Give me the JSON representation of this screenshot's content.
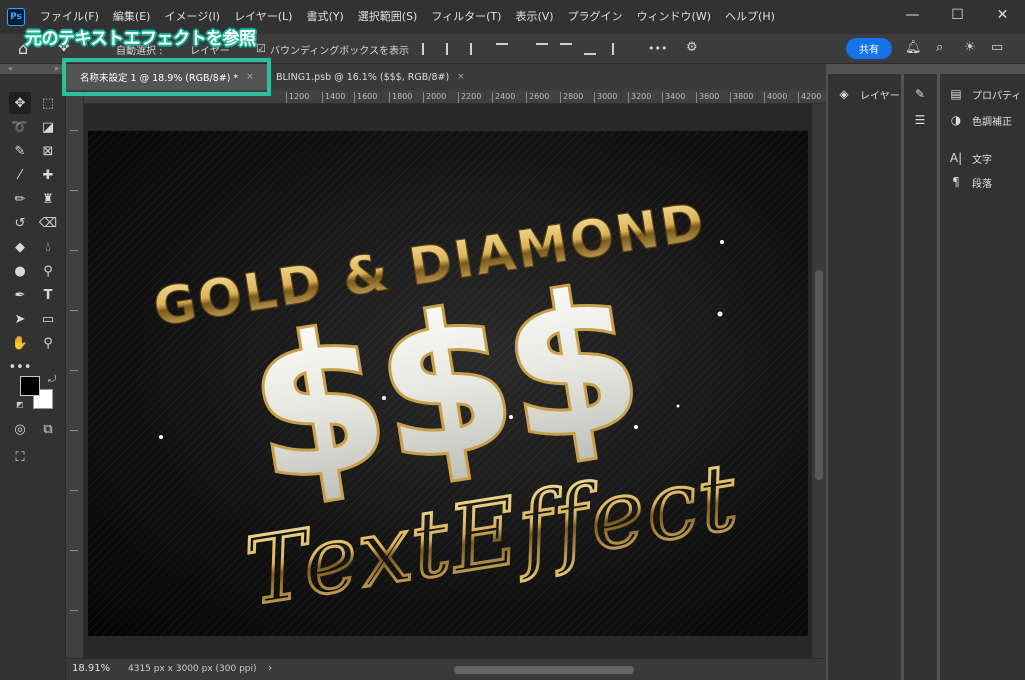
{
  "app": {
    "logo": "Ps"
  },
  "menu": [
    "ファイル(F)",
    "編集(E)",
    "イメージ(I)",
    "レイヤー(L)",
    "書式(Y)",
    "選択範囲(S)",
    "フィルター(T)",
    "表示(V)",
    "プラグイン",
    "ウィンドウ(W)",
    "ヘルプ(H)"
  ],
  "window": {
    "minimize": "—",
    "maximize": "☐",
    "close": "✕"
  },
  "options": {
    "auto_select": "自動選択 :",
    "layer_select": "レイヤー",
    "bounding_box": "バウンディングボックスを表示",
    "more": "•••",
    "share": "共有"
  },
  "annotation": {
    "title": "元のテキストエフェクトを参照"
  },
  "tabs": [
    {
      "label": "名称未設定 1 @ 18.9% (RGB/8#) *",
      "close": "×"
    },
    {
      "label": "BLING1.psb @ 16.1% ($$$, RGB/8#)",
      "close": "×"
    }
  ],
  "ruler": [
    "1200",
    "1400",
    "1600",
    "1800",
    "2000",
    "2200",
    "2400",
    "2600",
    "2800",
    "3000",
    "3200",
    "3400",
    "3600",
    "3800",
    "4000",
    "4200"
  ],
  "artwork": {
    "line1": "GOLD & DIAMOND",
    "line2": "$$$",
    "line3": "TextEffect",
    "colors": {
      "gold": "#d9b25a",
      "gold_dark": "#7a5a1e",
      "diamond": "#e8e8e2",
      "background": "#0c0c0c"
    }
  },
  "status": {
    "zoom": "18.91%",
    "docinfo": "4315 px x 3000 px (300 ppi)",
    "arrow": "›"
  },
  "panels": {
    "layers": "レイヤー",
    "properties": "プロパティ",
    "adjustments": "色調補正",
    "character": "文字",
    "paragraph": "段落"
  },
  "icons": {
    "home": "home-icon",
    "move": "move-icon",
    "bell": "bell-icon",
    "search": "search-icon",
    "lightbulb": "lightbulb-icon",
    "workspace": "workspace-icon",
    "gear": "gear-icon"
  }
}
